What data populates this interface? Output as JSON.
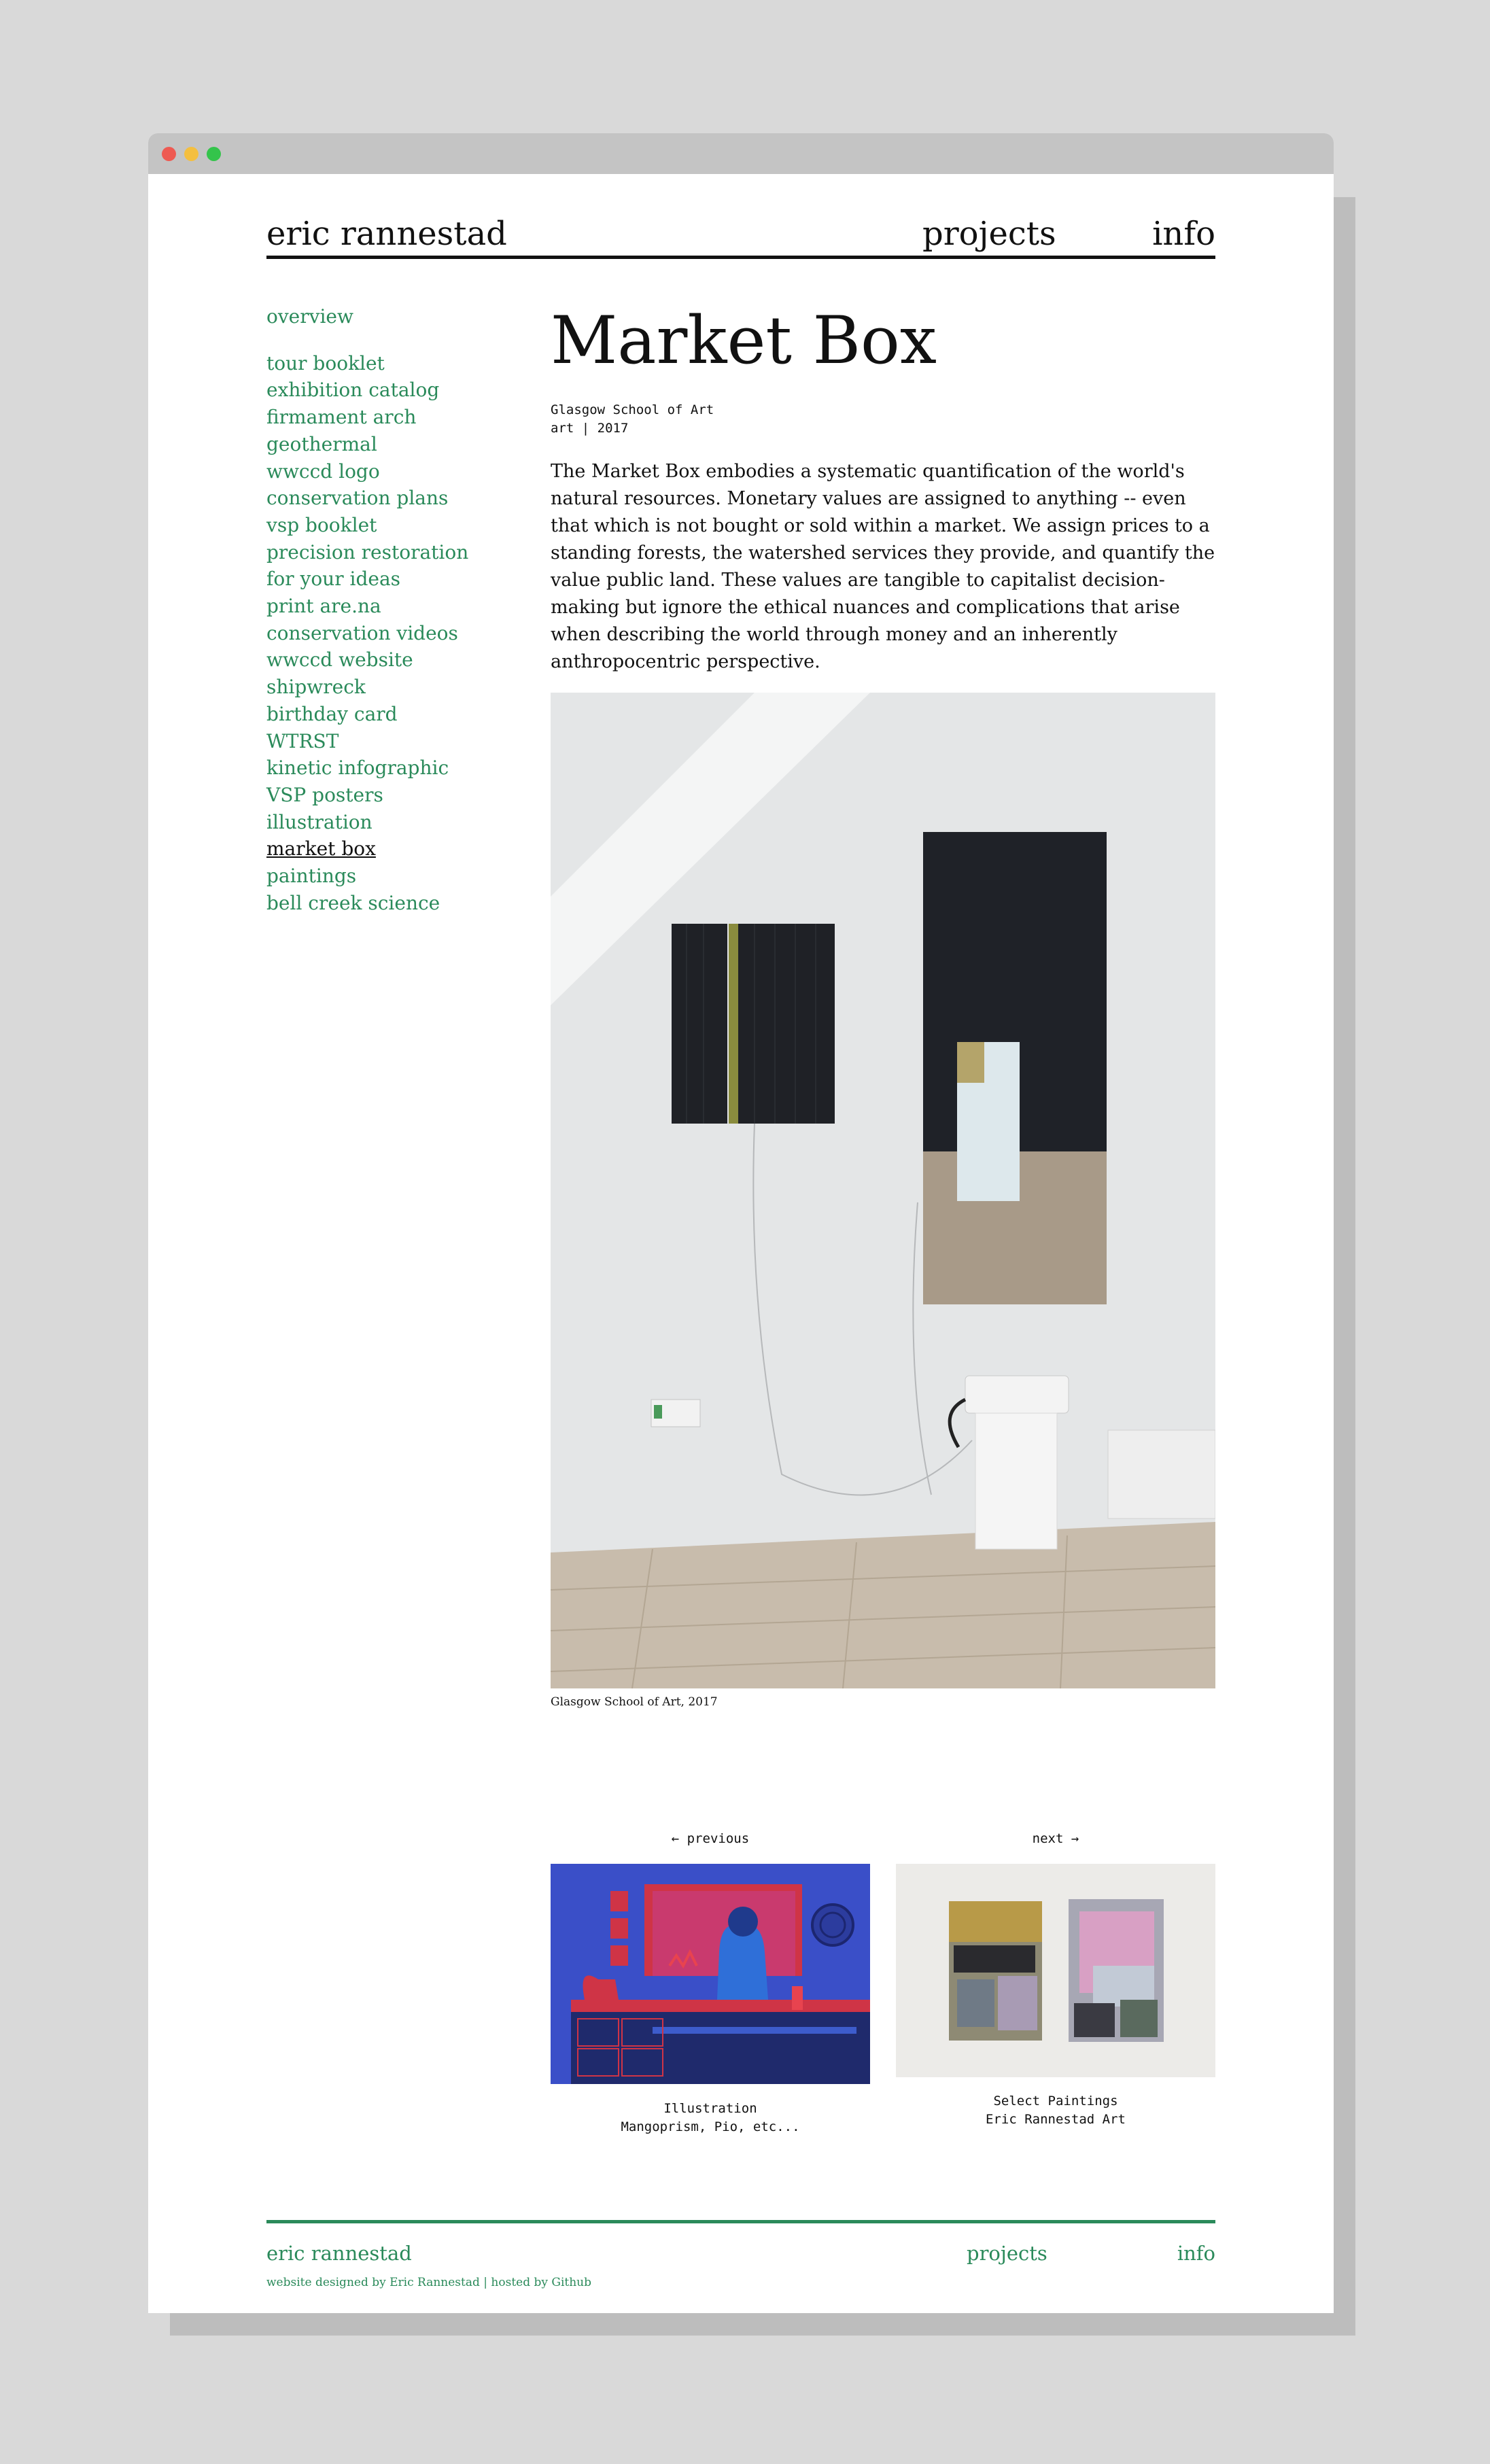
{
  "window": {
    "controls": [
      "close",
      "minimize",
      "maximize"
    ]
  },
  "header": {
    "brand": "eric rannestad",
    "nav": {
      "projects": "projects",
      "info": "info"
    }
  },
  "sidebar": {
    "overview": "overview",
    "items": [
      "tour booklet",
      "exhibition catalog",
      "firmament arch",
      "geothermal",
      "wwccd logo",
      "conservation plans",
      "vsp booklet",
      "precision restoration",
      "for your ideas",
      "print are.na",
      "conservation videos",
      "wwccd website",
      "shipwreck",
      "birthday card",
      "WTRST",
      "kinetic infographic",
      "VSP posters",
      "illustration",
      "market box",
      "paintings",
      "bell creek science"
    ],
    "current": "market box"
  },
  "main": {
    "title": "Market Box",
    "meta_line1": "Glasgow School of Art",
    "meta_line2": "art | 2017",
    "description": "The Market Box embodies a systematic quantification of the world's natural resources. Monetary values are assigned to anything -- even that which is not bought or sold within a market. We assign prices to a standing forests, the watershed services they provide, and quantify the value public land. These values are tangible to capitalist decision-making but ignore the ethical nuances and complications that arise when describing the world through money and an inherently anthropocentric perspective.",
    "photo_caption": "Glasgow School of Art, 2017"
  },
  "pagination": {
    "previous": {
      "label": "← previous",
      "title": "Illustration",
      "subtitle": "Mangoprism, Pio, etc..."
    },
    "next": {
      "label": "next →",
      "title": "Select Paintings",
      "subtitle": "Eric Rannestad Art"
    }
  },
  "footer": {
    "brand": "eric rannestad",
    "projects": "projects",
    "info": "info",
    "credit": "website designed by Eric Rannestad | hosted by Github"
  },
  "colors": {
    "accent": "#2a8a5a",
    "text": "#111111",
    "background": "#d9d9d9"
  }
}
